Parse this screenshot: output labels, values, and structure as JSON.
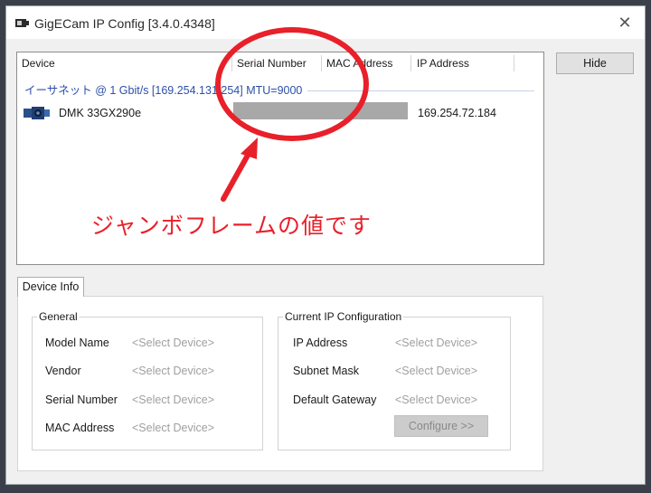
{
  "window": {
    "title": "GigECam IP Config [3.4.0.4348]",
    "close_glyph": "✕"
  },
  "device_list": {
    "columns": [
      "Device",
      "Serial Number",
      "MAC Address",
      "IP Address"
    ],
    "group_label": "イーサネット @ 1 Gbit/s [169.254.131.254] MTU=9000",
    "devices": [
      {
        "name": "DMK 33GX290e",
        "serial": "",
        "mac": "",
        "ip": "169.254.72.184"
      }
    ]
  },
  "buttons": {
    "hide": "Hide",
    "configure": "Configure >>"
  },
  "annotation": {
    "text": "ジャンボフレームの値です",
    "color": "#e8202a"
  },
  "device_info": {
    "tab_label": "Device Info",
    "general": {
      "title": "General",
      "fields": [
        {
          "label": "Model Name",
          "value": "<Select Device>"
        },
        {
          "label": "Vendor",
          "value": "<Select Device>"
        },
        {
          "label": "Serial Number",
          "value": "<Select Device>"
        },
        {
          "label": "MAC Address",
          "value": "<Select Device>"
        }
      ]
    },
    "ip_config": {
      "title": "Current IP Configuration",
      "fields": [
        {
          "label": "IP Address",
          "value": "<Select Device>"
        },
        {
          "label": "Subnet Mask",
          "value": "<Select Device>"
        },
        {
          "label": "Default Gateway",
          "value": "<Select Device>"
        }
      ]
    }
  },
  "icons": {
    "app": "camera-app-icon",
    "device": "camera-device-icon",
    "close": "close-icon"
  },
  "colors": {
    "group_text": "#2d4fa8",
    "placeholder_text": "#a0a0a0",
    "annotation_red": "#e8202a"
  }
}
